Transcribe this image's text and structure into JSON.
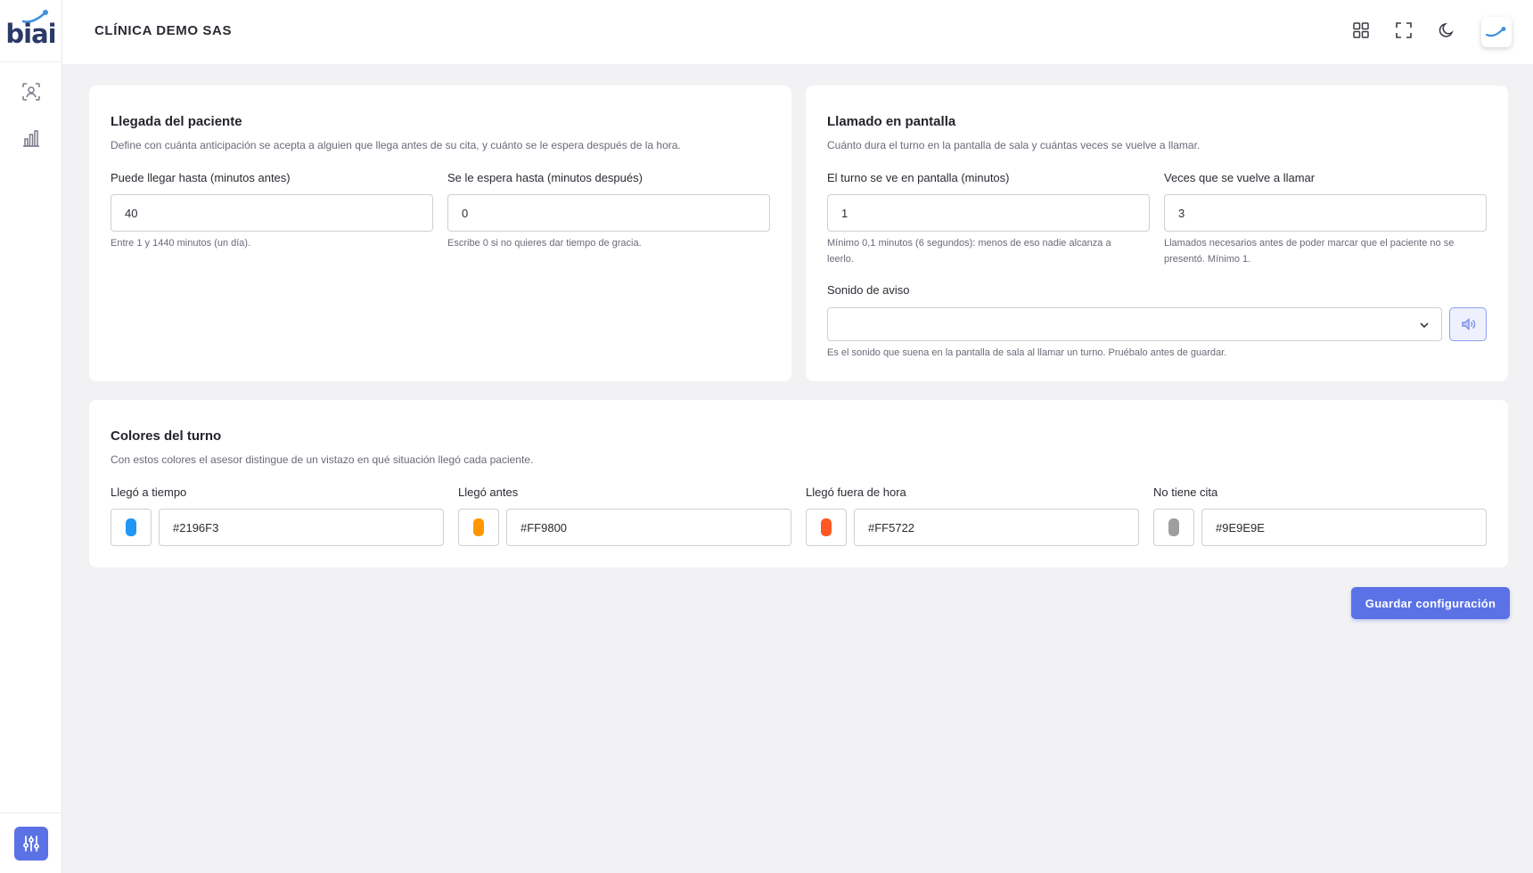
{
  "header": {
    "title": "CLÍNICA DEMO SAS",
    "icons": [
      "apps-grid-icon",
      "fullscreen-icon",
      "moon-icon"
    ]
  },
  "sidebar": {
    "logo_text": "biai",
    "items": [
      {
        "icon": "person-scan-icon"
      },
      {
        "icon": "bar-chart-icon"
      }
    ],
    "bottom_icon": "sliders-icon"
  },
  "llegada": {
    "title": "Llegada del paciente",
    "description": "Define con cuánta anticipación se acepta a alguien que llega antes de su cita, y cuánto se le espera después de la hora.",
    "fields": [
      {
        "label": "Puede llegar hasta (minutos antes)",
        "value": "40",
        "hint": "Entre 1 y 1440 minutos (un día)."
      },
      {
        "label": "Se le espera hasta (minutos después)",
        "value": "0",
        "hint": "Escribe 0 si no quieres dar tiempo de gracia."
      }
    ]
  },
  "llamado": {
    "title": "Llamado en pantalla",
    "description": "Cuánto dura el turno en la pantalla de sala y cuántas veces se vuelve a llamar.",
    "fields": [
      {
        "label": "El turno se ve en pantalla (minutos)",
        "value": "1",
        "hint_line1": "Mínimo 0,1 minutos (6 segundos): menos de eso nadie alcanza a",
        "hint_line2": "leerlo."
      },
      {
        "label": "Veces que se vuelve a llamar",
        "value": "3",
        "hint_line1": "Llamados necesarios antes de poder marcar que el paciente no se",
        "hint_line2": "presentó. Mínimo 1."
      }
    ],
    "sound": {
      "label": "Sonido de aviso",
      "selected": "",
      "hint": "Es el sonido que suena en la pantalla de sala al llamar un turno. Pruébalo antes de guardar."
    }
  },
  "colores": {
    "title": "Colores del turno",
    "description": "Con estos colores el asesor distingue de un vistazo en qué situación llegó cada paciente.",
    "items": [
      {
        "label": "Llegó a tiempo",
        "value": "#2196F3",
        "color": "#2196F3"
      },
      {
        "label": "Llegó antes",
        "value": "#FF9800",
        "color": "#FF9800"
      },
      {
        "label": "Llegó fuera de hora",
        "value": "#FF5722",
        "color": "#FF5722"
      },
      {
        "label": "No tiene cita",
        "value": "#9E9E9E",
        "color": "#9E9E9E"
      }
    ]
  },
  "actions": {
    "save_label": "Guardar configuración"
  },
  "theme": {
    "accent": "#5B72E6"
  }
}
